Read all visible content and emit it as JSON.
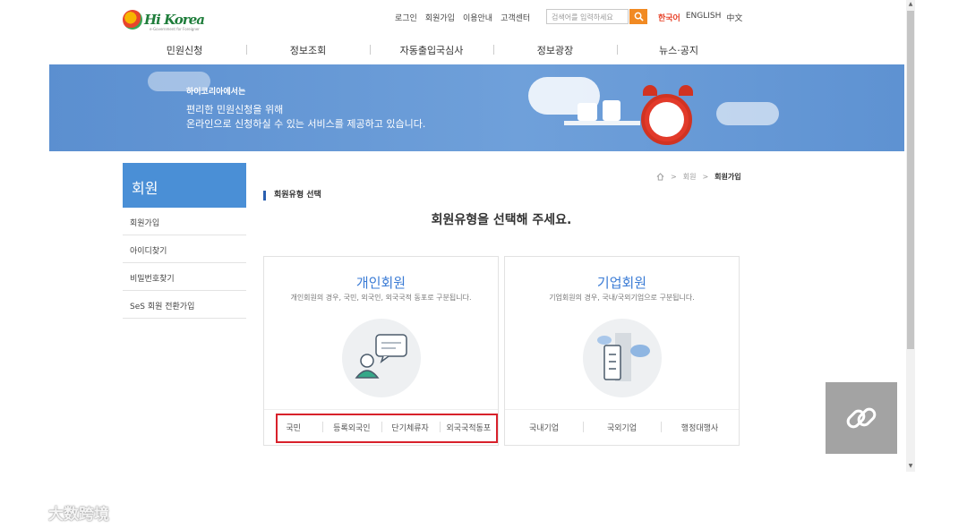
{
  "header": {
    "logo_text": "Hi Korea",
    "logo_sub": "e-Government for Foreigner",
    "util_links": [
      "로그인",
      "회원가입",
      "이용안내",
      "고객센터"
    ],
    "search_placeholder": "검색어를 입력하세요",
    "languages": [
      "한국어",
      "ENGLISH",
      "中文"
    ]
  },
  "gnb": [
    "민원신청",
    "정보조회",
    "자동출입국심사",
    "정보광장",
    "뉴스·공지"
  ],
  "banner": {
    "line1": "하이코리아에서는",
    "line2": "편리한 민원신청을 위해",
    "line3": "온라인으로 신청하실 수 있는 서비스를 제공하고 있습니다."
  },
  "sidebar": {
    "title": "회원",
    "items": [
      "회원가입",
      "아이디찾기",
      "비밀번호찾기",
      "SeS 회원 전환가입"
    ]
  },
  "breadcrumb": [
    "회원",
    "회원가입"
  ],
  "section_title": "회원유형 선택",
  "heading": "회원유형을 선택해 주세요.",
  "cards": [
    {
      "title": "개인회원",
      "desc": "개인회원의 경우, 국민, 외국인, 외국국적 동포로 구분됩니다.",
      "options": [
        "국민",
        "등록외국인",
        "단기체류자",
        "외국국적동포"
      ]
    },
    {
      "title": "기업회원",
      "desc": "기업회원의 경우, 국내/국외기업으로 구분됩니다.",
      "options": [
        "국내기업",
        "국외기업",
        "행정대행사"
      ]
    }
  ],
  "watermark": "大数跨境",
  "colors": {
    "accent": "#4a8fd6",
    "highlight": "#d8212b",
    "search_button": "#f18a23"
  }
}
